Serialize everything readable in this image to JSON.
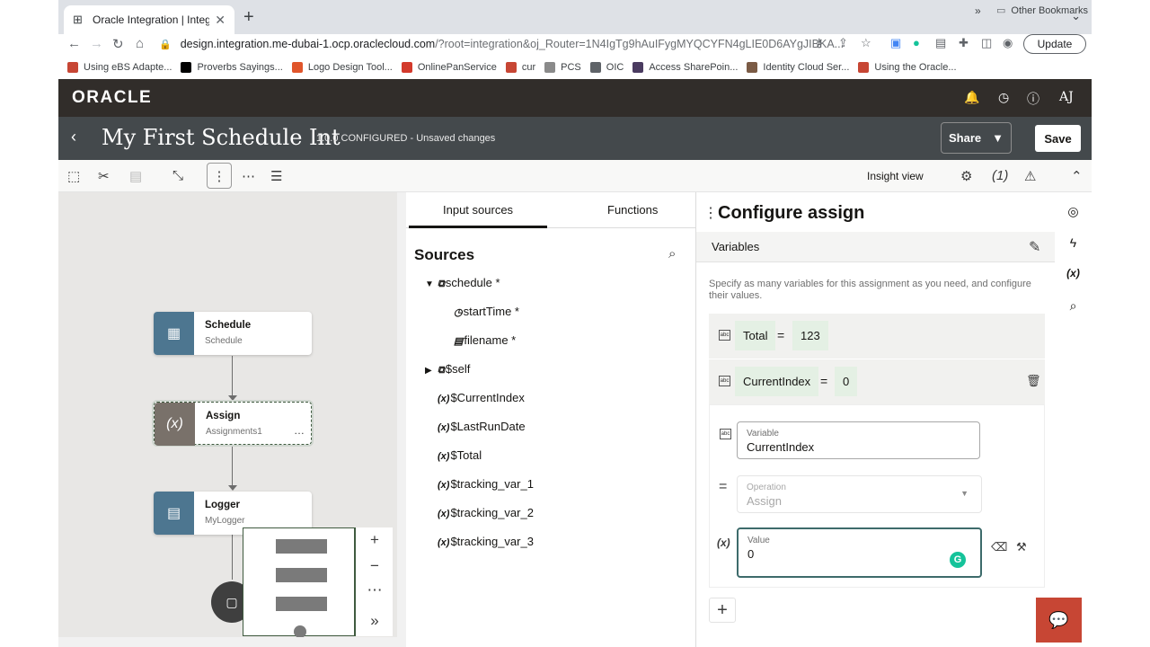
{
  "browser": {
    "tab_title": "Oracle Integration | Integration",
    "url_host": "design.integration.me-dubai-1.ocp.oraclecloud.com",
    "url_path": "/?root=integration&oj_Router=1N4IgTg9hAuIFygMYQCYFN4gLIE0D6AYgJIBKA...",
    "update_label": "Update",
    "bookmarks": [
      {
        "label": "Using eBS Adapte...",
        "color": "#c74634"
      },
      {
        "label": "Proverbs Sayings...",
        "color": "#000000",
        "glyph": "AKC"
      },
      {
        "label": "Logo Design Tool...",
        "color": "#e0552b"
      },
      {
        "label": "OnlinePanService",
        "color": "#d33a2c",
        "glyph": "NSDL"
      },
      {
        "label": "cur",
        "color": "#c74634"
      },
      {
        "label": "PCS",
        "color": "#8a8a8a"
      },
      {
        "label": "OIC",
        "color": "#5f6368"
      },
      {
        "label": "Access SharePoin...",
        "color": "#4a3b60"
      },
      {
        "label": "Identity Cloud Ser...",
        "color": "#7b5b45"
      },
      {
        "label": "Using the Oracle...",
        "color": "#c74634"
      }
    ],
    "other_bookmarks": "Other Bookmarks"
  },
  "app": {
    "logo": "ORACLE",
    "user_initials": "AJ",
    "title": "My First Schedule Int",
    "status": "1.0.0 CONFIGURED - Unsaved changes",
    "share_label": "Share",
    "save_label": "Save",
    "insight_label": "Insight view"
  },
  "canvas": {
    "nodes": [
      {
        "name": "Schedule",
        "sub": "Schedule"
      },
      {
        "name": "Assign",
        "sub": "Assignments1"
      },
      {
        "name": "Logger",
        "sub": "MyLogger"
      }
    ]
  },
  "sources_panel": {
    "tabs": [
      "Input sources",
      "Functions"
    ],
    "heading": "Sources",
    "tree": [
      {
        "label": "schedule *",
        "icon": "schema",
        "indent": 0,
        "expander": "▼"
      },
      {
        "label": "startTime *",
        "icon": "clock",
        "indent": 1,
        "expander": ""
      },
      {
        "label": "filename *",
        "icon": "abc",
        "indent": 1,
        "expander": ""
      },
      {
        "label": "$self",
        "icon": "schema",
        "indent": 0,
        "expander": "▶"
      },
      {
        "label": "$CurrentIndex",
        "icon": "x",
        "indent": 0,
        "expander": ""
      },
      {
        "label": "$LastRunDate",
        "icon": "x",
        "indent": 0,
        "expander": ""
      },
      {
        "label": "$Total",
        "icon": "x",
        "indent": 0,
        "expander": ""
      },
      {
        "label": "$tracking_var_1",
        "icon": "x",
        "indent": 0,
        "expander": ""
      },
      {
        "label": "$tracking_var_2",
        "icon": "x",
        "indent": 0,
        "expander": ""
      },
      {
        "label": "$tracking_var_3",
        "icon": "x",
        "indent": 0,
        "expander": ""
      }
    ]
  },
  "configure": {
    "title": "Configure assign",
    "section": "Variables",
    "hint": "Specify as many variables for this assignment as you need, and configure their values.",
    "assignments": [
      {
        "variable": "Total",
        "operator": "=",
        "value": "123"
      },
      {
        "variable": "CurrentIndex",
        "operator": "=",
        "value": "0"
      }
    ],
    "editor": {
      "variable_label": "Variable",
      "variable_value": "CurrentIndex",
      "operation_label": "Operation",
      "operation_value": "Assign",
      "value_label": "Value",
      "value_value": "0"
    }
  }
}
